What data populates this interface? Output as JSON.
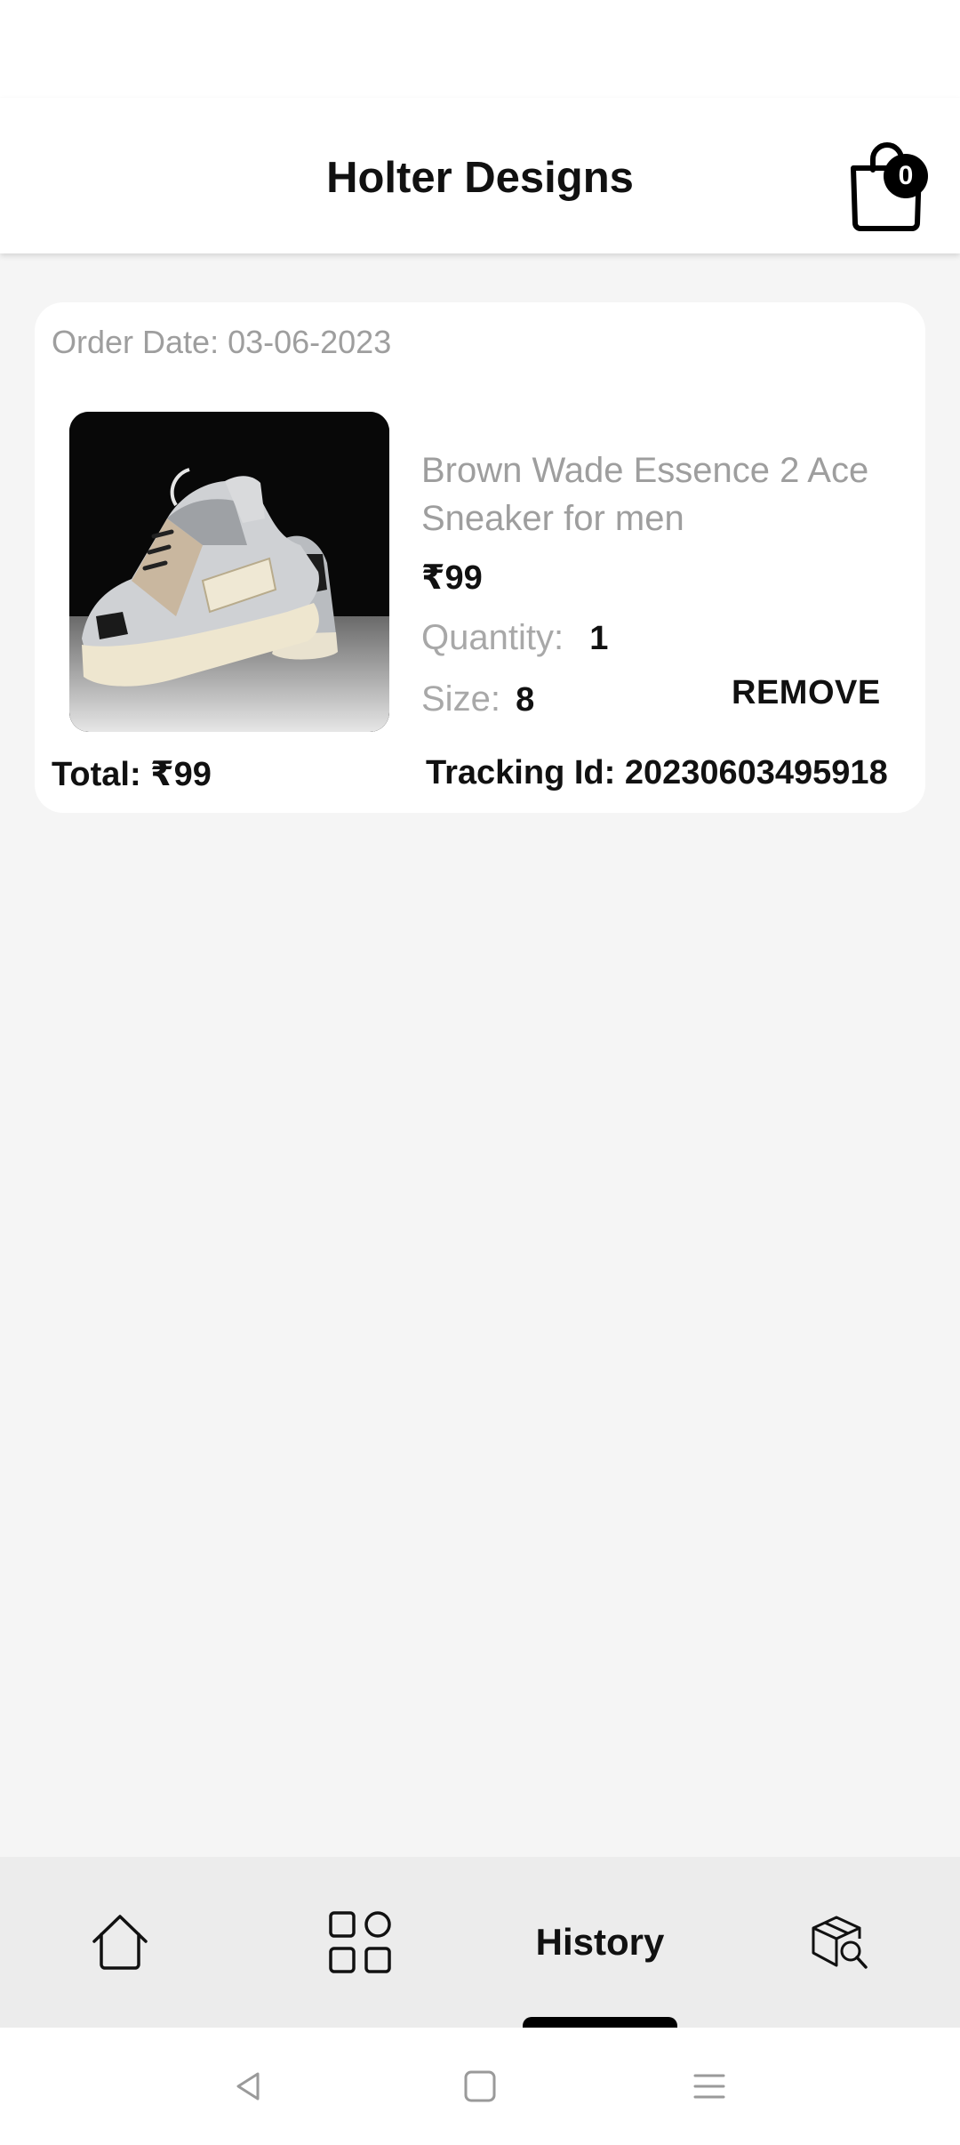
{
  "app_bar": {
    "title": "Holter Designs",
    "cart_count": "0"
  },
  "order": {
    "order_date": "Order Date: 03-06-2023",
    "product_name": "Brown Wade Essence 2 Ace Sneaker for men",
    "price": "₹99",
    "quantity_label": "Quantity:",
    "quantity_value": "1",
    "size_label": "Size:",
    "size_value": "8",
    "remove_label": "REMOVE",
    "total": "Total: ₹99",
    "tracking": "Tracking Id: 20230603495918"
  },
  "bottom_nav": {
    "items": [
      {
        "icon": "home-icon",
        "active": false
      },
      {
        "icon": "categories-grid-icon",
        "active": false
      },
      {
        "label": "History",
        "active": true
      },
      {
        "icon": "package-search-icon",
        "active": false
      }
    ]
  },
  "colors": {
    "accent": "#000000",
    "muted_text": "#9e9e9e",
    "background": "#f5f5f5"
  }
}
